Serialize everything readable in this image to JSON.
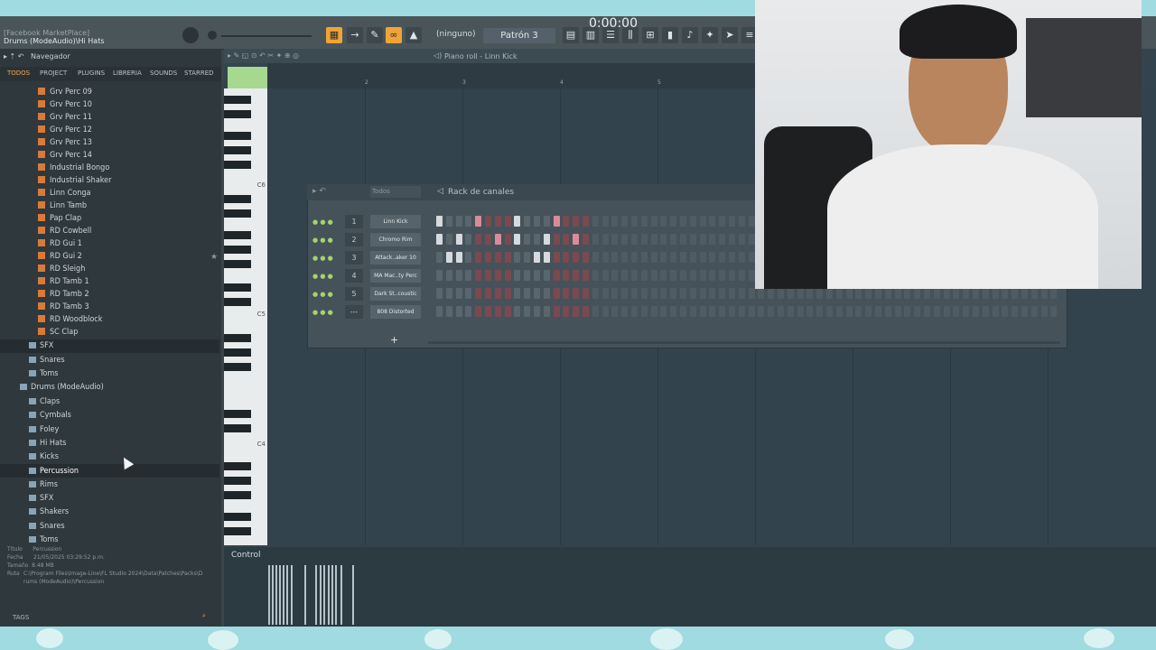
{
  "window": {
    "hint_line1": "[Facebook MarketPlace]",
    "hint_line2": "Drums (ModeAudio)\\Hi Hats",
    "time": "0:00:00"
  },
  "toolbar": {
    "snap": "(ninguno)",
    "pattern": "Patrón 3"
  },
  "browser": {
    "title": "Navegador",
    "tabs": [
      "TODOS",
      "PROJECT",
      "PLUGINS",
      "LIBRERIA",
      "SOUNDS",
      "STARRED"
    ],
    "files": [
      "Grv Perc 09",
      "Grv Perc 10",
      "Grv Perc 11",
      "Grv Perc 12",
      "Grv Perc 13",
      "Grv Perc 14",
      "Industrial Bongo",
      "Industrial Shaker",
      "Linn Conga",
      "Linn Tamb",
      "Pap Clap",
      "RD Cowbell",
      "RD Gui 1",
      "RD Gui 2",
      "RD Sleigh",
      "RD Tamb 1",
      "RD Tamb 2",
      "RD Tamb 3",
      "RD Woodblock",
      "SC Clap"
    ],
    "folders_a": [
      "SFX",
      "Snares",
      "Toms"
    ],
    "parent": "Drums (ModeAudio)",
    "folders_b": [
      "Claps",
      "Cymbals",
      "Foley",
      "Hi Hats",
      "Kicks",
      "Percussion",
      "Rims",
      "SFX",
      "Shakers",
      "Snares",
      "Toms"
    ],
    "info": {
      "title_label": "Título",
      "title_value": "Percussion",
      "date_label": "Fecha",
      "date_value": "21/05/2025 03:29:52 p.m.",
      "size_label": "Tamaño",
      "size_value": "8.48 MB",
      "path_label": "Ruta",
      "path_value": "C:\\Program Files\\Image-Line\\FL Studio 2024\\Data\\Patches\\Packs\\Drums (ModeAudio)\\Percussion"
    },
    "tags_label": "TAGS"
  },
  "piano_roll": {
    "title": "Piano roll - Linn Kick",
    "bar_numbers": [
      "2",
      "3",
      "4",
      "5"
    ],
    "octaves": [
      "C6",
      "C5",
      "C4"
    ]
  },
  "channel_rack": {
    "filter": "Todos",
    "title": "Rack de canales",
    "channels": [
      {
        "num": "1",
        "name": "Linn Kick",
        "steps": [
          1,
          0,
          0,
          0,
          1,
          0,
          0,
          0,
          1,
          0,
          0,
          0,
          1,
          0,
          0,
          0
        ],
        "color": "on"
      },
      {
        "num": "2",
        "name": "Chromo Rim",
        "steps": [
          1,
          0,
          1,
          0,
          0,
          0,
          1,
          0,
          1,
          0,
          0,
          1,
          0,
          0,
          1,
          0
        ],
        "color": "on"
      },
      {
        "num": "3",
        "name": "Attack..aker 10",
        "steps": [
          0,
          1,
          1,
          0,
          0,
          0,
          0,
          0,
          0,
          0,
          1,
          1,
          0,
          0,
          0,
          0
        ],
        "color": "on"
      },
      {
        "num": "4",
        "name": "MA Mac..ty Perc",
        "steps": [
          0,
          0,
          0,
          0,
          0,
          0,
          0,
          0,
          0,
          0,
          0,
          0,
          0,
          0,
          0,
          0
        ],
        "color": "on"
      },
      {
        "num": "5",
        "name": "Dark St..coustic",
        "steps": [
          0,
          0,
          0,
          0,
          0,
          0,
          0,
          0,
          0,
          0,
          0,
          0,
          0,
          0,
          0,
          0
        ],
        "color": "on"
      },
      {
        "num": "---",
        "name": "808 Distorted",
        "steps": [
          0,
          0,
          0,
          0,
          0,
          0,
          0,
          0,
          0,
          0,
          0,
          0,
          0,
          0,
          0,
          0
        ],
        "color": "on"
      }
    ],
    "add_label": "+"
  },
  "control": {
    "label": "Control"
  }
}
